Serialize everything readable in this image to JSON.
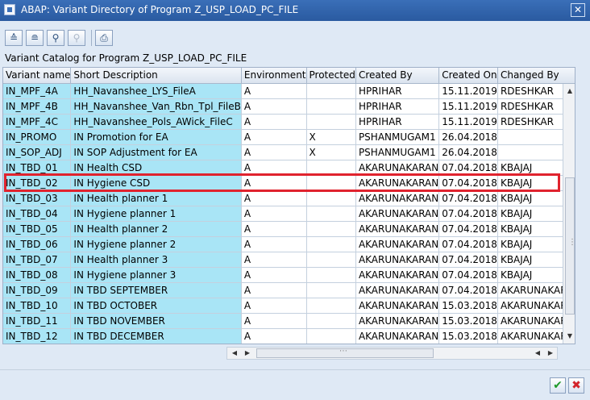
{
  "window": {
    "title": "ABAP: Variant Directory of Program Z_USP_LOAD_PC_FILE",
    "close_glyph": "✕"
  },
  "toolbar": {
    "buttons": [
      {
        "name": "details-icon",
        "glyph": "≙"
      },
      {
        "name": "filter-icon",
        "glyph": "≘"
      },
      {
        "name": "find-icon",
        "glyph": "⚲"
      },
      {
        "name": "find-next-icon",
        "glyph": "⚲"
      },
      {
        "name": "print-icon",
        "glyph": "⎙"
      }
    ]
  },
  "catalog_title": "Variant Catalog for Program Z_USP_LOAD_PC_FILE",
  "table": {
    "headers": [
      "Variant name",
      "Short Description",
      "Environment",
      "Protected",
      "Created By",
      "Created On",
      "Changed By"
    ],
    "rows": [
      [
        "IN_MPF_4A",
        "HH_Navanshee_LYS_FileA",
        "A",
        "",
        "HPRIHAR",
        "15.11.2019",
        "RDESHKAR"
      ],
      [
        "IN_MPF_4B",
        "HH_Navanshee_Van_Rbn_Tpl_FileB",
        "A",
        "",
        "HPRIHAR",
        "15.11.2019",
        "RDESHKAR"
      ],
      [
        "IN_MPF_4C",
        "HH_Navanshee_Pols_AWick_FileC",
        "A",
        "",
        "HPRIHAR",
        "15.11.2019",
        "RDESHKAR"
      ],
      [
        "IN_PROMO",
        "IN Promotion for EA",
        "A",
        "X",
        "PSHANMUGAM1",
        "26.04.2018",
        ""
      ],
      [
        "IN_SOP_ADJ",
        "IN SOP Adjustment for EA",
        "A",
        "X",
        "PSHANMUGAM1",
        "26.04.2018",
        ""
      ],
      [
        "IN_TBD_01",
        "IN Health CSD",
        "A",
        "",
        "AKARUNAKARAN",
        "07.04.2018",
        "KBAJAJ"
      ],
      [
        "IN_TBD_02",
        "IN Hygiene CSD",
        "A",
        "",
        "AKARUNAKARAN",
        "07.04.2018",
        "KBAJAJ"
      ],
      [
        "IN_TBD_03",
        "IN Health planner 1",
        "A",
        "",
        "AKARUNAKARAN",
        "07.04.2018",
        "KBAJAJ"
      ],
      [
        "IN_TBD_04",
        "IN Hygiene planner 1",
        "A",
        "",
        "AKARUNAKARAN",
        "07.04.2018",
        "KBAJAJ"
      ],
      [
        "IN_TBD_05",
        "IN Health planner 2",
        "A",
        "",
        "AKARUNAKARAN",
        "07.04.2018",
        "KBAJAJ"
      ],
      [
        "IN_TBD_06",
        "IN Hygiene planner 2",
        "A",
        "",
        "AKARUNAKARAN",
        "07.04.2018",
        "KBAJAJ"
      ],
      [
        "IN_TBD_07",
        "IN Health planner 3",
        "A",
        "",
        "AKARUNAKARAN",
        "07.04.2018",
        "KBAJAJ"
      ],
      [
        "IN_TBD_08",
        "IN Hygiene planner 3",
        "A",
        "",
        "AKARUNAKARAN",
        "07.04.2018",
        "KBAJAJ"
      ],
      [
        "IN_TBD_09",
        "IN TBD SEPTEMBER",
        "A",
        "",
        "AKARUNAKARAN",
        "07.04.2018",
        "AKARUNAKARAN"
      ],
      [
        "IN_TBD_10",
        "IN TBD OCTOBER",
        "A",
        "",
        "AKARUNAKARAN",
        "15.03.2018",
        "AKARUNAKARAN"
      ],
      [
        "IN_TBD_11",
        "IN TBD NOVEMBER",
        "A",
        "",
        "AKARUNAKARAN",
        "15.03.2018",
        "AKARUNAKARAN"
      ],
      [
        "IN_TBD_12",
        "IN TBD DECEMBER",
        "A",
        "",
        "AKARUNAKARAN",
        "15.03.2018",
        "AKARUNAKARAN"
      ]
    ],
    "highlighted_variant": "IN_TBD_02"
  },
  "footer": {
    "ok_glyph": "✔",
    "cancel_glyph": "✖"
  },
  "colors": {
    "key_column": "#a9e5f6",
    "highlight_border": "#e0232e",
    "title_bar": "#2a5aa0"
  }
}
